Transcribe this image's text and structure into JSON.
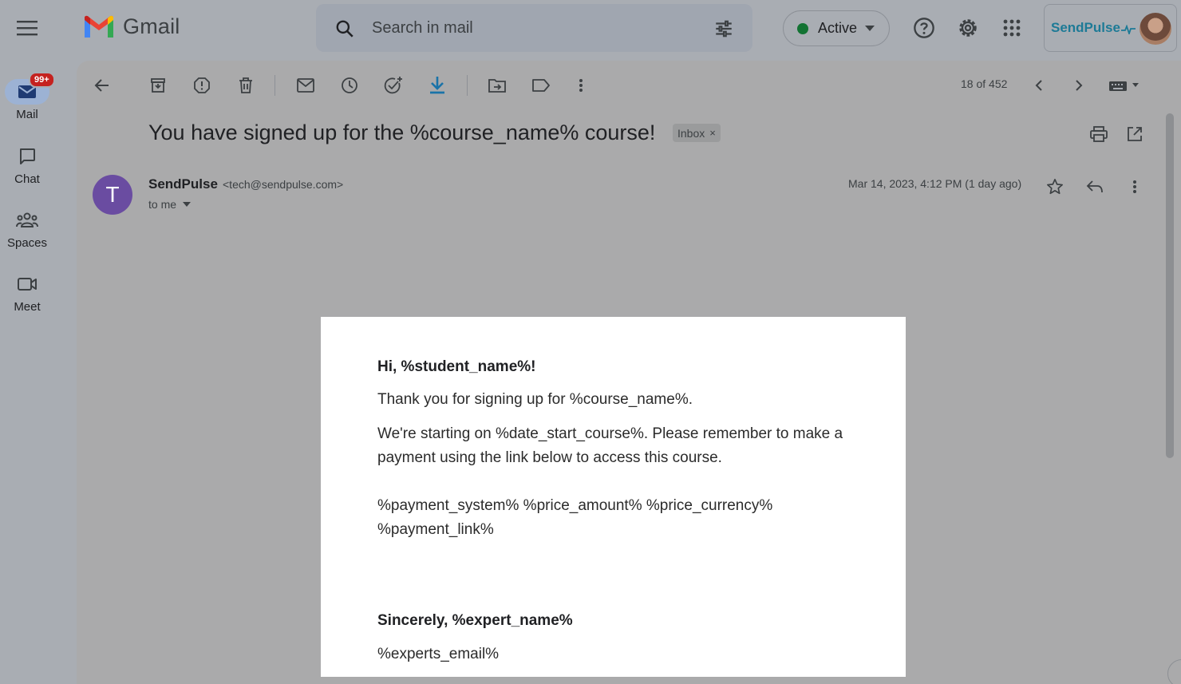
{
  "app": {
    "name": "Gmail"
  },
  "search": {
    "placeholder": "Search in mail"
  },
  "status": {
    "label": "Active",
    "color": "#137333"
  },
  "account": {
    "brand": "SendPulse"
  },
  "rail": {
    "items": [
      {
        "label": "Mail",
        "icon": "mail-icon",
        "badge": "99+",
        "active": true
      },
      {
        "label": "Chat",
        "icon": "chat-icon"
      },
      {
        "label": "Spaces",
        "icon": "spaces-icon"
      },
      {
        "label": "Meet",
        "icon": "meet-icon"
      }
    ]
  },
  "toolbar": {
    "pager": "18 of 452",
    "actions": [
      "back-arrow-icon",
      "archive-icon",
      "report-spam-icon",
      "delete-icon",
      "mark-unread-icon",
      "snooze-icon",
      "add-task-icon",
      "download-icon",
      "move-to-icon",
      "label-icon",
      "more-vert-icon"
    ]
  },
  "message": {
    "subject": "You have signed up for the %course_name% course!",
    "label_chip": "Inbox",
    "chip_close": "×",
    "sender_initial": "T",
    "sender_name": "SendPulse",
    "sender_email": "<tech@sendpulse.com>",
    "to": "to me",
    "date": "Mar 14, 2023, 4:12 PM (1 day ago)"
  },
  "email_body": {
    "greeting": "Hi, %student_name%!",
    "line1": "Thank you for signing up for %course_name%.",
    "line2a": "We're starting on %date_start_course%. Please remember to make a",
    "line2b": "payment using the link below to access this course.",
    "line3a": "%payment_system% %price_amount% %price_currency%",
    "line3b": "%payment_link%",
    "signoff": "Sincerely, %expert_name%",
    "email": "%experts_email%"
  },
  "colors": {
    "accent_download": "#1a73a8",
    "sender_avatar": "#6a4ca1",
    "badge": "#c5221f"
  }
}
